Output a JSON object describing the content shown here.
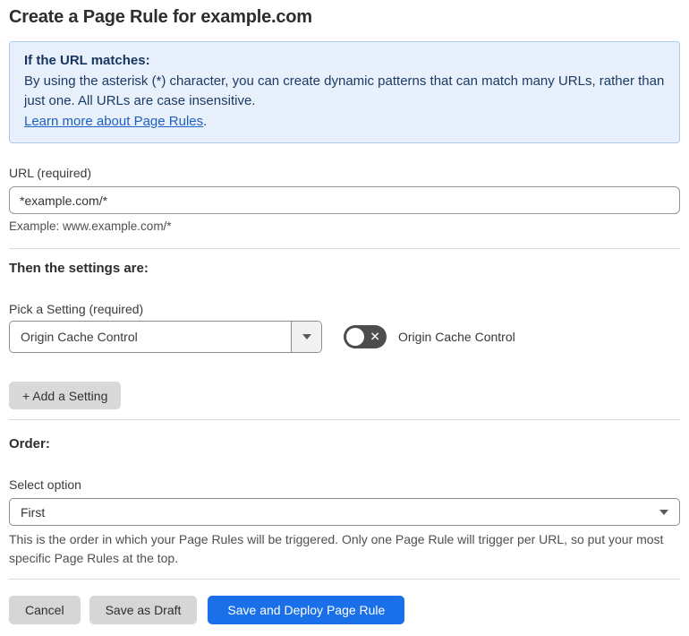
{
  "page": {
    "title": "Create a Page Rule for example.com"
  },
  "info_box": {
    "heading": "If the URL matches:",
    "body": "By using the asterisk (*) character, you can create dynamic patterns that can match many URLs, rather than just one. All URLs are case insensitive.",
    "link_label": "Learn more about Page Rules",
    "link_suffix": "."
  },
  "url_section": {
    "label": "URL (required)",
    "value": "*example.com/*",
    "helper": "Example: www.example.com/*"
  },
  "settings_section": {
    "heading": "Then the settings are:",
    "picker_label": "Pick a Setting (required)",
    "selected_setting": "Origin Cache Control",
    "toggle_state": "off",
    "toggle_glyph": "✕",
    "toggle_label": "Origin Cache Control",
    "add_setting_label": "+ Add a Setting"
  },
  "order_section": {
    "heading": "Order:",
    "select_label": "Select option",
    "selected_option": "First",
    "helper": "This is the order in which your Page Rules will be triggered. Only one Page Rule will trigger per URL, so put your most specific Page Rules at the top."
  },
  "footer": {
    "cancel_label": "Cancel",
    "save_draft_label": "Save as Draft",
    "save_deploy_label": "Save and Deploy Page Rule"
  },
  "colors": {
    "accent_blue": "#1a70e8",
    "info_bg": "#e8f1fb",
    "info_border": "#abc9ed",
    "info_text": "#1b3a66",
    "link_blue": "#1f5fc2",
    "toggle_off_bg": "#4d4d4d",
    "button_gray": "#d6d6d6"
  }
}
